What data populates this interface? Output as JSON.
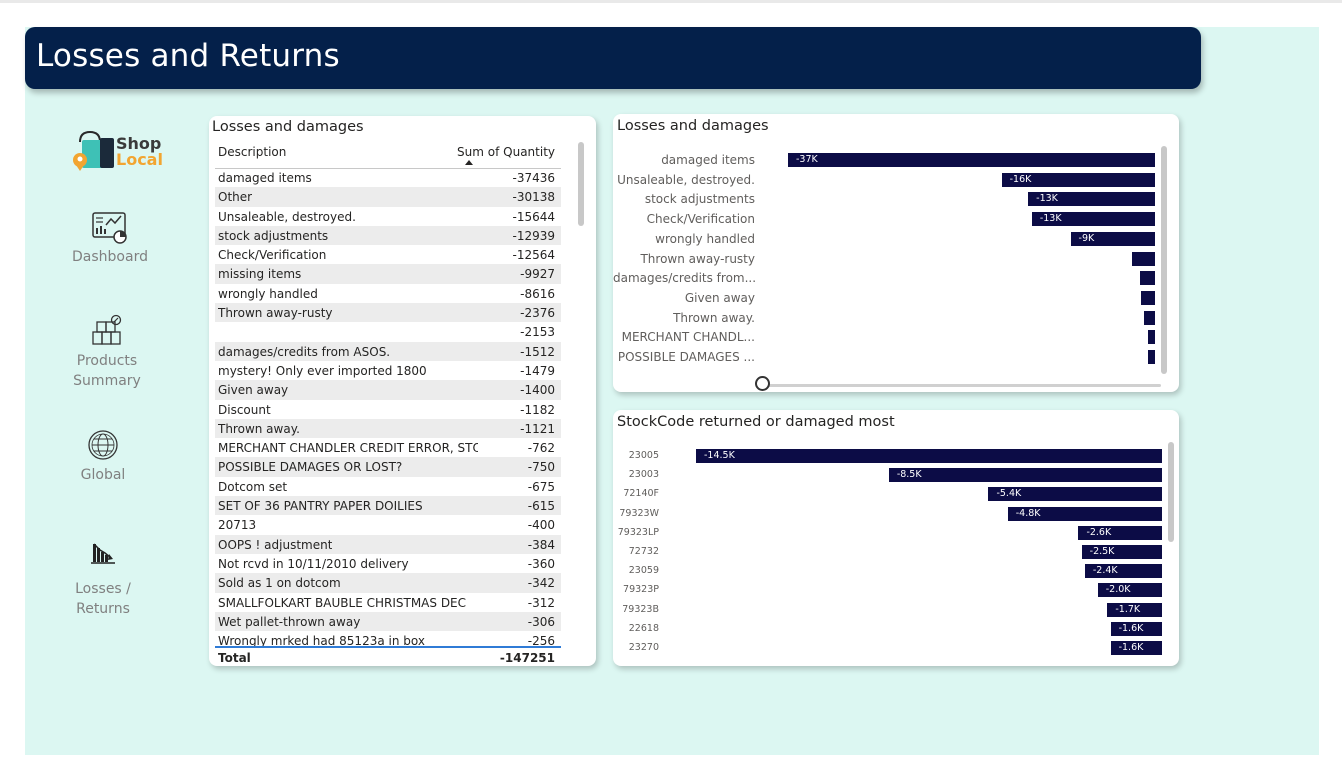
{
  "header": {
    "title": "Losses and Returns"
  },
  "logo": {
    "line1": "Shop",
    "line2": "Local",
    "icon": "shopping-bag-pin-icon"
  },
  "nav": [
    {
      "label": "Dashboard",
      "icon": "dashboard-icon"
    },
    {
      "label": "Products Summary",
      "icon": "boxes-icon"
    },
    {
      "label": "Global",
      "icon": "globe-icon"
    },
    {
      "label": "Losses / Returns",
      "icon": "losses-chart-icon"
    }
  ],
  "colors": {
    "header": "#04204a",
    "canvas": "#dcf7f2",
    "bar": "#0c0c46",
    "total_line": "#2f7bd6"
  },
  "table": {
    "title": "Losses and damages",
    "columns": [
      "Description",
      "Sum of Quantity"
    ],
    "sort": "Sum of Quantity ascending",
    "rows": [
      [
        "damaged items",
        "-37436"
      ],
      [
        "Other",
        "-30138"
      ],
      [
        "Unsaleable, destroyed.",
        "-15644"
      ],
      [
        "stock adjustments",
        "-12939"
      ],
      [
        "Check/Verification",
        "-12564"
      ],
      [
        "missing items",
        "-9927"
      ],
      [
        "wrongly handled",
        "-8616"
      ],
      [
        "Thrown away-rusty",
        "-2376"
      ],
      [
        "",
        "-2153"
      ],
      [
        "damages/credits from ASOS.",
        "-1512"
      ],
      [
        "mystery! Only ever imported 1800",
        "-1479"
      ],
      [
        "Given away",
        "-1400"
      ],
      [
        "Discount",
        "-1182"
      ],
      [
        "Thrown away.",
        "-1121"
      ],
      [
        "MERCHANT CHANDLER CREDIT ERROR, STO",
        "-762"
      ],
      [
        "POSSIBLE DAMAGES OR LOST?",
        "-750"
      ],
      [
        "Dotcom set",
        "-675"
      ],
      [
        "SET OF 36 PANTRY PAPER DOILIES",
        "-615"
      ],
      [
        "20713",
        "-400"
      ],
      [
        "OOPS ! adjustment",
        "-384"
      ],
      [
        "Not rcvd in 10/11/2010 delivery",
        "-360"
      ],
      [
        "Sold as 1 on dotcom",
        "-342"
      ],
      [
        "SMALLFOLKART BAUBLE CHRISTMAS DEC",
        "-312"
      ],
      [
        "Wet pallet-thrown away",
        "-306"
      ],
      [
        "Wrongly mrked had 85123a in box",
        "-256"
      ]
    ],
    "total_label": "Total",
    "total_value": "-147251"
  },
  "chart_data": [
    {
      "type": "bar",
      "orientation": "horizontal",
      "title": "Losses and damages",
      "categories": [
        "damaged items",
        "Unsaleable, destroyed.",
        "stock adjustments",
        "Check/Verification",
        "wrongly handled",
        "Thrown away-rusty",
        "damages/credits from...",
        "Given away",
        "Thrown away.",
        "MERCHANT CHANDL...",
        "POSSIBLE DAMAGES ..."
      ],
      "values": [
        -37436,
        -15644,
        -12939,
        -12564,
        -8616,
        -2376,
        -1512,
        -1400,
        -1121,
        -762,
        -750
      ],
      "data_labels": [
        "-37K",
        "-16K",
        "-13K",
        "-13K",
        "-9K",
        "",
        "",
        "",
        "",
        "",
        ""
      ],
      "xlim": [
        -37436,
        0
      ]
    },
    {
      "type": "bar",
      "orientation": "horizontal",
      "title": "StockCode returned or damaged most",
      "categories": [
        "23005",
        "23003",
        "72140F",
        "79323W",
        "79323LP",
        "72732",
        "23059",
        "79323P",
        "79323B",
        "22618",
        "23270"
      ],
      "values": [
        -14500,
        -8500,
        -5400,
        -4800,
        -2600,
        -2500,
        -2400,
        -2000,
        -1700,
        -1600,
        -1600
      ],
      "data_labels": [
        "-14.5K",
        "-8.5K",
        "-5.4K",
        "-4.8K",
        "-2.6K",
        "-2.5K",
        "-2.4K",
        "-2.0K",
        "-1.7K",
        "-1.6K",
        "-1.6K"
      ],
      "xlim": [
        -14500,
        0
      ]
    }
  ]
}
